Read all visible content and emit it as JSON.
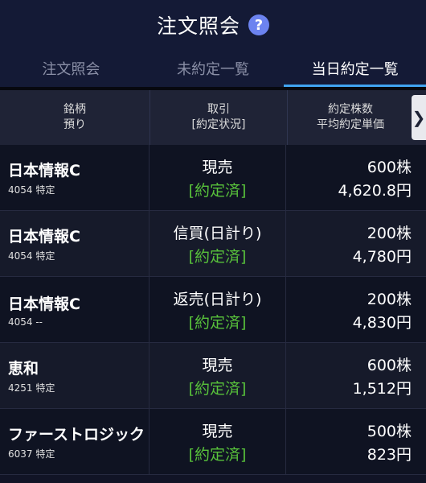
{
  "header": {
    "title": "注文照会",
    "help_icon": "question-circle-icon"
  },
  "tabs": [
    {
      "label": "注文照会",
      "active": false
    },
    {
      "label": "未約定一覧",
      "active": false
    },
    {
      "label": "当日約定一覧",
      "active": true
    }
  ],
  "columns": {
    "col1": [
      "銘柄",
      "預り"
    ],
    "col2": [
      "取引",
      "[約定状況]"
    ],
    "col3": [
      "約定株数",
      "平均約定単価"
    ],
    "next_arrow": "❯"
  },
  "rows": [
    {
      "name": "日本情報C",
      "sub": "4054 特定",
      "trade": "現売",
      "status": "[約定済]",
      "qty": "600株",
      "price": "4,620.8円"
    },
    {
      "name": "日本情報C",
      "sub": "4054 特定",
      "trade": "信買(日計り)",
      "status": "[約定済]",
      "qty": "200株",
      "price": "4,780円"
    },
    {
      "name": "日本情報C",
      "sub": "4054 --",
      "trade": "返売(日計り)",
      "status": "[約定済]",
      "qty": "200株",
      "price": "4,830円"
    },
    {
      "name": "恵和",
      "sub": "4251 特定",
      "trade": "現売",
      "status": "[約定済]",
      "qty": "600株",
      "price": "1,512円"
    },
    {
      "name": "ファーストロジック",
      "sub": "6037 特定",
      "trade": "現売",
      "status": "[約定済]",
      "qty": "500株",
      "price": "823円"
    }
  ],
  "colors": {
    "accent": "#41a4f0",
    "status_green": "#58c23b",
    "help_icon": "#6c83f0"
  }
}
